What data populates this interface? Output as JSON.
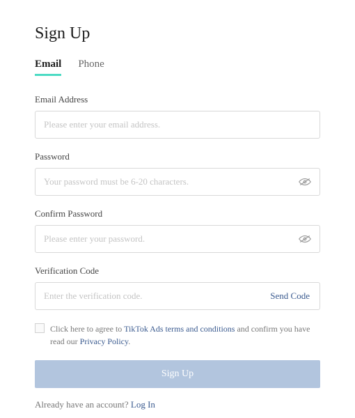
{
  "title": "Sign Up",
  "tabs": {
    "email": "Email",
    "phone": "Phone"
  },
  "fields": {
    "email": {
      "label": "Email Address",
      "placeholder": "Please enter your email address.",
      "value": ""
    },
    "password": {
      "label": "Password",
      "placeholder": "Your password must be 6-20 characters.",
      "value": ""
    },
    "confirm": {
      "label": "Confirm Password",
      "placeholder": "Please enter your password.",
      "value": ""
    },
    "verification": {
      "label": "Verification Code",
      "placeholder": "Enter the verification code.",
      "value": "",
      "sendCode": "Send Code"
    }
  },
  "agreement": {
    "prefix": "Click here to agree to ",
    "termsLink": "TikTok Ads terms and conditions",
    "middle": " and confirm you have read our ",
    "privacyLink": "Privacy Policy",
    "suffix": "."
  },
  "submitButton": "Sign Up",
  "loginPrompt": {
    "text": "Already have an account? ",
    "link": "Log In"
  }
}
